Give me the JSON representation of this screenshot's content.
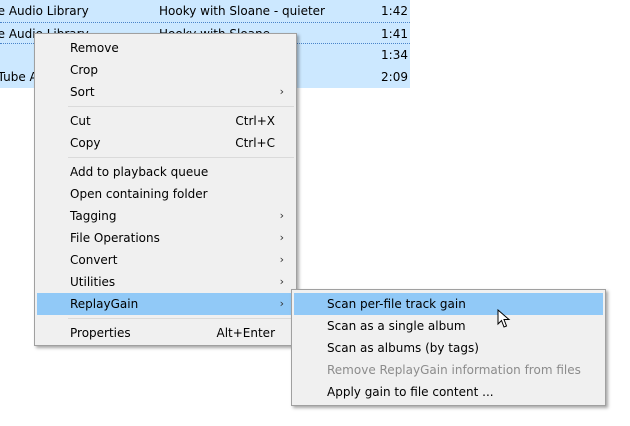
{
  "tracks": [
    {
      "artist": "be Audio Library",
      "title": "Hooky with Sloane - quieter",
      "duration": "1:42"
    },
    {
      "artist": "be Audio Library",
      "title": "Hooky with Sloane",
      "duration": "1:41"
    },
    {
      "artist": "",
      "title": "",
      "duration": "1:34"
    },
    {
      "artist": "uTube A",
      "title": "",
      "duration": "2:09"
    }
  ],
  "menu": {
    "remove": "Remove",
    "crop": "Crop",
    "sort": "Sort",
    "cut": "Cut",
    "cut_shortcut": "Ctrl+X",
    "copy": "Copy",
    "copy_shortcut": "Ctrl+C",
    "add_queue": "Add to playback queue",
    "open_folder": "Open containing folder",
    "tagging": "Tagging",
    "file_ops": "File Operations",
    "convert": "Convert",
    "utilities": "Utilities",
    "replaygain": "ReplayGain",
    "properties": "Properties",
    "properties_shortcut": "Alt+Enter",
    "submenu_arrow": "›"
  },
  "submenu": {
    "scan_track": "Scan per-file track gain",
    "scan_album": "Scan as a single album",
    "scan_albums_tags": "Scan as albums (by tags)",
    "remove_info": "Remove ReplayGain information from files",
    "apply_gain": "Apply gain to file content ..."
  },
  "colors": {
    "row_selected": "#cce8ff",
    "menu_bg": "#f0f0f0",
    "menu_highlight": "#91c9f7",
    "disabled_text": "#8c8c8c"
  },
  "icons": {
    "cursor": "mouse-pointer-icon"
  }
}
